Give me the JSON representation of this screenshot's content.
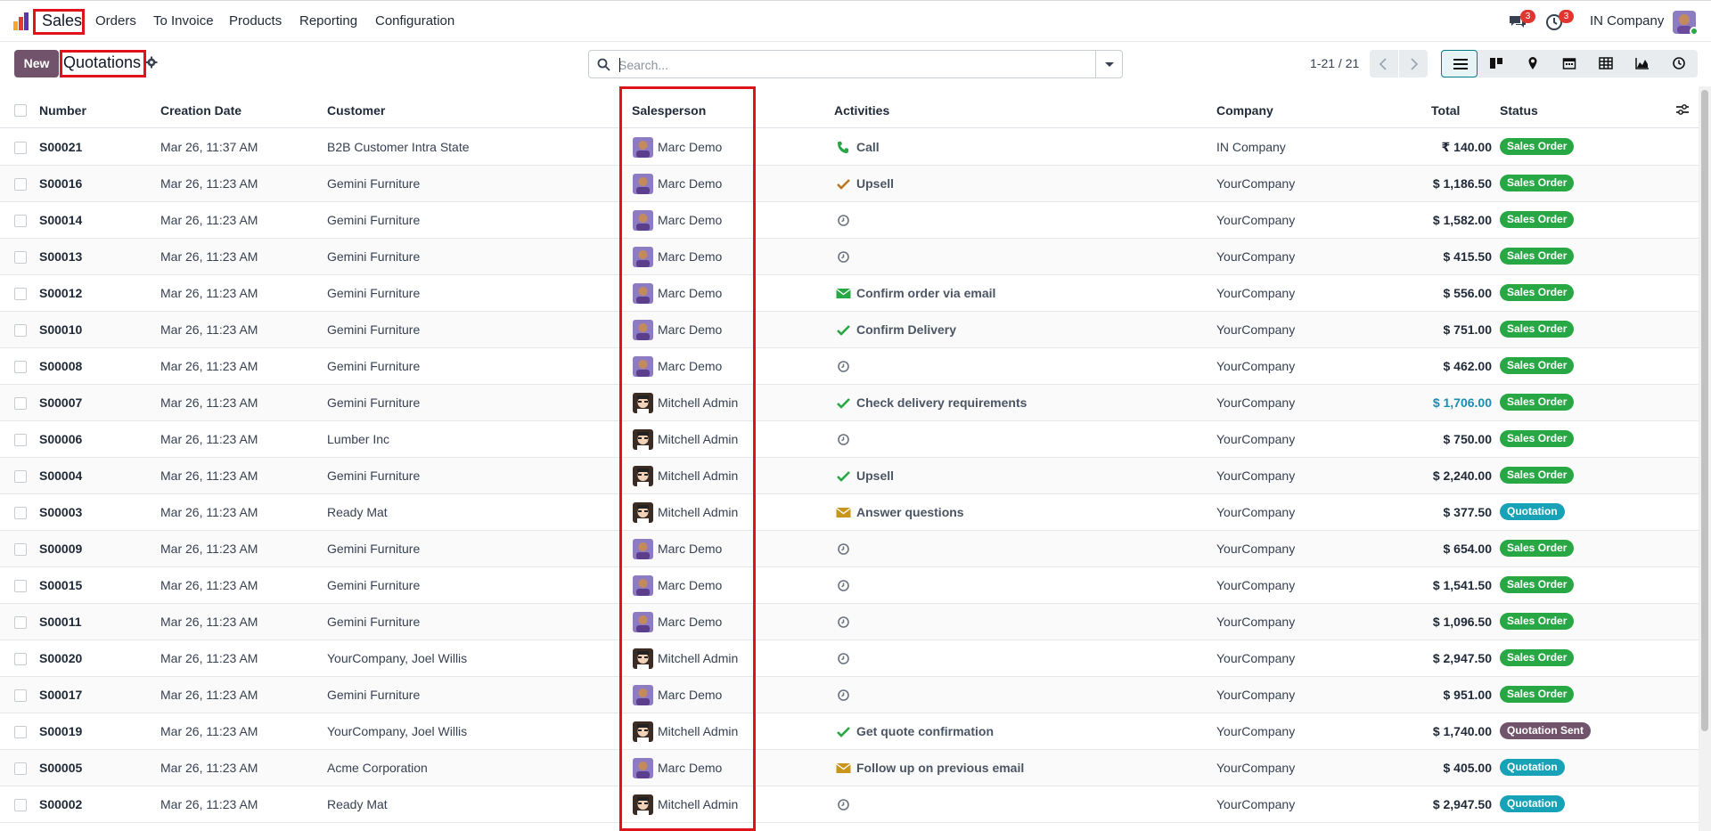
{
  "navbar": {
    "app_name": "Sales",
    "menu": [
      "Orders",
      "To Invoice",
      "Products",
      "Reporting",
      "Configuration"
    ],
    "messages_count": "3",
    "activities_count": "3",
    "company": "IN Company"
  },
  "control_panel": {
    "new_label": "New",
    "title": "Quotations",
    "search_placeholder": "Search...",
    "pager": "1-21 / 21",
    "views": [
      "list-view",
      "kanban-view",
      "map-view",
      "calendar-view",
      "pivot-view",
      "graph-view",
      "activity-view"
    ],
    "active_view": "list-view"
  },
  "table": {
    "columns": [
      "Number",
      "Creation Date",
      "Customer",
      "Salesperson",
      "Activities",
      "Company",
      "Total",
      "Status"
    ],
    "rows": [
      {
        "number": "S00021",
        "date": "Mar 26, 11:37 AM",
        "customer": "B2B Customer Intra State",
        "salesperson": "Marc Demo",
        "activity_icon": "phone-icon",
        "activity": "Call",
        "company": "IN Company",
        "total": "₹ 140.00",
        "status": "Sales Order"
      },
      {
        "number": "S00016",
        "date": "Mar 26, 11:23 AM",
        "customer": "Gemini Furniture",
        "salesperson": "Marc Demo",
        "activity_icon": "upsell-icon",
        "activity": "Upsell",
        "company": "YourCompany",
        "total": "$ 1,186.50",
        "status": "Sales Order"
      },
      {
        "number": "S00014",
        "date": "Mar 26, 11:23 AM",
        "customer": "Gemini Furniture",
        "salesperson": "Marc Demo",
        "activity_icon": "clock-icon",
        "activity": "",
        "company": "YourCompany",
        "total": "$ 1,582.00",
        "status": "Sales Order"
      },
      {
        "number": "S00013",
        "date": "Mar 26, 11:23 AM",
        "customer": "Gemini Furniture",
        "salesperson": "Marc Demo",
        "activity_icon": "clock-icon",
        "activity": "",
        "company": "YourCompany",
        "total": "$ 415.50",
        "status": "Sales Order"
      },
      {
        "number": "S00012",
        "date": "Mar 26, 11:23 AM",
        "customer": "Gemini Furniture",
        "salesperson": "Marc Demo",
        "activity_icon": "email-green-icon",
        "activity": "Confirm order via email",
        "company": "YourCompany",
        "total": "$ 556.00",
        "status": "Sales Order"
      },
      {
        "number": "S00010",
        "date": "Mar 26, 11:23 AM",
        "customer": "Gemini Furniture",
        "salesperson": "Marc Demo",
        "activity_icon": "check-icon",
        "activity": "Confirm Delivery",
        "company": "YourCompany",
        "total": "$ 751.00",
        "status": "Sales Order"
      },
      {
        "number": "S00008",
        "date": "Mar 26, 11:23 AM",
        "customer": "Gemini Furniture",
        "salesperson": "Marc Demo",
        "activity_icon": "clock-icon",
        "activity": "",
        "company": "YourCompany",
        "total": "$ 462.00",
        "status": "Sales Order"
      },
      {
        "number": "S00007",
        "date": "Mar 26, 11:23 AM",
        "customer": "Gemini Furniture",
        "salesperson": "Mitchell Admin",
        "activity_icon": "check-icon",
        "activity": "Check delivery requirements",
        "company": "YourCompany",
        "total": "$ 1,706.00",
        "total_link": true,
        "status": "Sales Order"
      },
      {
        "number": "S00006",
        "date": "Mar 26, 11:23 AM",
        "customer": "Lumber Inc",
        "salesperson": "Mitchell Admin",
        "activity_icon": "clock-icon",
        "activity": "",
        "company": "YourCompany",
        "total": "$ 750.00",
        "status": "Sales Order"
      },
      {
        "number": "S00004",
        "date": "Mar 26, 11:23 AM",
        "customer": "Gemini Furniture",
        "salesperson": "Mitchell Admin",
        "activity_icon": "check-icon",
        "activity": "Upsell",
        "company": "YourCompany",
        "total": "$ 2,240.00",
        "status": "Sales Order"
      },
      {
        "number": "S00003",
        "date": "Mar 26, 11:23 AM",
        "customer": "Ready Mat",
        "salesperson": "Mitchell Admin",
        "activity_icon": "email-orange-icon",
        "activity": "Answer questions",
        "company": "YourCompany",
        "total": "$ 377.50",
        "status": "Quotation"
      },
      {
        "number": "S00009",
        "date": "Mar 26, 11:23 AM",
        "customer": "Gemini Furniture",
        "salesperson": "Marc Demo",
        "activity_icon": "clock-icon",
        "activity": "",
        "company": "YourCompany",
        "total": "$ 654.00",
        "status": "Sales Order"
      },
      {
        "number": "S00015",
        "date": "Mar 26, 11:23 AM",
        "customer": "Gemini Furniture",
        "salesperson": "Marc Demo",
        "activity_icon": "clock-icon",
        "activity": "",
        "company": "YourCompany",
        "total": "$ 1,541.50",
        "status": "Sales Order"
      },
      {
        "number": "S00011",
        "date": "Mar 26, 11:23 AM",
        "customer": "Gemini Furniture",
        "salesperson": "Marc Demo",
        "activity_icon": "clock-icon",
        "activity": "",
        "company": "YourCompany",
        "total": "$ 1,096.50",
        "status": "Sales Order"
      },
      {
        "number": "S00020",
        "date": "Mar 26, 11:23 AM",
        "customer": "YourCompany, Joel Willis",
        "salesperson": "Mitchell Admin",
        "activity_icon": "clock-icon",
        "activity": "",
        "company": "YourCompany",
        "total": "$ 2,947.50",
        "status": "Sales Order"
      },
      {
        "number": "S00017",
        "date": "Mar 26, 11:23 AM",
        "customer": "Gemini Furniture",
        "salesperson": "Marc Demo",
        "activity_icon": "clock-icon",
        "activity": "",
        "company": "YourCompany",
        "total": "$ 951.00",
        "status": "Sales Order"
      },
      {
        "number": "S00019",
        "date": "Mar 26, 11:23 AM",
        "customer": "YourCompany, Joel Willis",
        "salesperson": "Mitchell Admin",
        "activity_icon": "check-icon",
        "activity": "Get quote confirmation",
        "company": "YourCompany",
        "total": "$ 1,740.00",
        "status": "Quotation Sent"
      },
      {
        "number": "S00005",
        "date": "Mar 26, 11:23 AM",
        "customer": "Acme Corporation",
        "salesperson": "Marc Demo",
        "activity_icon": "email-orange-icon",
        "activity": "Follow up on previous email",
        "company": "YourCompany",
        "total": "$ 405.00",
        "status": "Quotation"
      },
      {
        "number": "S00002",
        "date": "Mar 26, 11:23 AM",
        "customer": "Ready Mat",
        "salesperson": "Mitchell Admin",
        "activity_icon": "clock-icon",
        "activity": "",
        "company": "YourCompany",
        "total": "$ 2,947.50",
        "status": "Quotation"
      }
    ]
  },
  "colors": {
    "primary": "#71546b",
    "accent": "#017e84",
    "highlight": "#e0131a",
    "status_sales_order": "#28a745",
    "status_quotation": "#17a2b8",
    "status_quotation_sent": "#71546b"
  }
}
